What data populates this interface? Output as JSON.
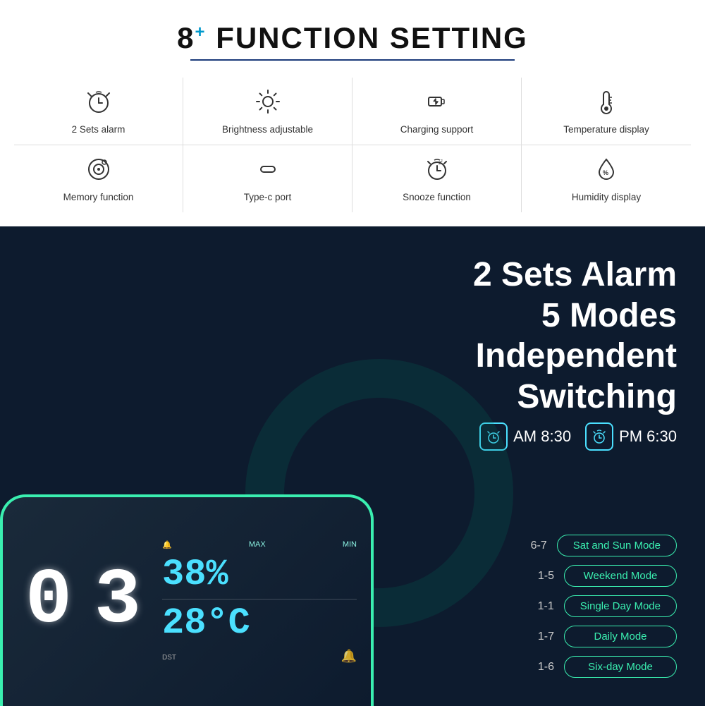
{
  "top": {
    "title_prefix": "8",
    "title_suffix": "FUNCTION SETTING",
    "features": [
      {
        "icon": "⏰",
        "label": "2 Sets alarm"
      },
      {
        "icon": "💡",
        "label": "Brightness adjustable"
      },
      {
        "icon": "🔌",
        "label": "Charging support"
      },
      {
        "icon": "🌡",
        "label": "Temperature display"
      },
      {
        "icon": "⚙",
        "label": "Memory function"
      },
      {
        "icon": "⊂⊃",
        "label": "Type-c port"
      },
      {
        "icon": "🔔",
        "label": "Snooze function"
      },
      {
        "icon": "💧",
        "label": "Humidity display"
      }
    ]
  },
  "bottom": {
    "headline_line1": "2 Sets Alarm",
    "headline_line2": "5 Modes Independent Switching",
    "alarm1_time": "AM 8:30",
    "alarm2_time": "PM 6:30",
    "device": {
      "digits": "03",
      "humidity": "38%",
      "temperature": "28°C",
      "dst_label": "DST",
      "max_label": "MAX",
      "min_label": "MIN"
    },
    "modes": [
      {
        "range": "6-7",
        "label": "Sat and Sun Mode"
      },
      {
        "range": "1-5",
        "label": "Weekend Mode"
      },
      {
        "range": "1-1",
        "label": "Single Day Mode"
      },
      {
        "range": "1-7",
        "label": "Daily Mode"
      },
      {
        "range": "1-6",
        "label": "Six-day Mode"
      }
    ]
  }
}
